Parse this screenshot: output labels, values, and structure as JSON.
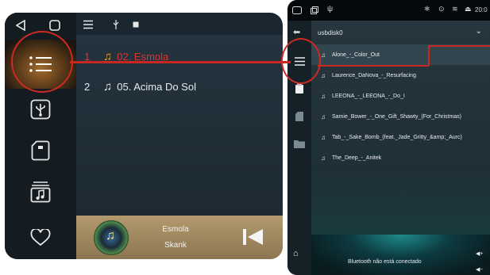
{
  "left_screen": {
    "nav_icons": [
      "back-icon",
      "home-icon",
      "menu-icon",
      "usb-icon",
      "sd-card-icon",
      "folder-music-icon",
      "heart-icon"
    ],
    "songs": [
      {
        "num": "1",
        "title": "02. Esmola"
      },
      {
        "num": "2",
        "title": "05. Acima Do Sol"
      }
    ],
    "player": {
      "title": "Esmola",
      "artist": "Skank"
    },
    "colors": {
      "accent": "#e0342a",
      "background": "#1a2730",
      "player_bg": "#a48b62"
    }
  },
  "right_screen": {
    "status": {
      "time": "20:0"
    },
    "folder": "usbdisk0",
    "songs": [
      "Alone_-_Color_Out",
      "Laurence_DaNova_-_Resurfacing",
      "LEEONA_-_LEEONA_-_Do_I",
      "Samie_Bower_-_One_Gift_Shawty_(For_Christmas)",
      "Tab_-_Sake_Bomb_(feat._Jade_Gritty_&amp;_Aurc)",
      "The_Deep_-_Anitek"
    ],
    "bluetooth_text": "Bluetooth não está conectado",
    "vol_up": "◀+",
    "vol_down": "◀−",
    "colors": {
      "highlight": "#33464f",
      "annotation": "#c8281f"
    }
  }
}
